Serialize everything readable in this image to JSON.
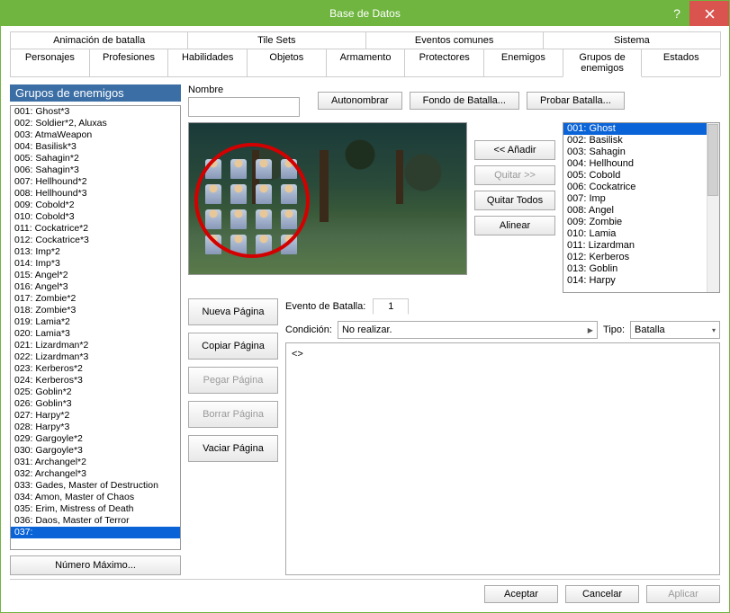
{
  "window": {
    "title": "Base de Datos"
  },
  "tabs_top": {
    "row1": [
      "Animación de batalla",
      "Tile Sets",
      "Eventos comunes",
      "Sistema"
    ],
    "row2": [
      "Personajes",
      "Profesiones",
      "Habilidades",
      "Objetos",
      "Armamento",
      "Protectores",
      "Enemigos",
      "Grupos de enemigos",
      "Estados"
    ],
    "active": "Grupos de enemigos"
  },
  "left": {
    "header": "Grupos de enemigos",
    "max_btn": "Número Máximo...",
    "items": [
      "001: Ghost*3",
      "002: Soldier*2, Aluxas",
      "003: AtmaWeapon",
      "004: Basilisk*3",
      "005: Sahagin*2",
      "006: Sahagin*3",
      "007: Hellhound*2",
      "008: Hellhound*3",
      "009: Cobold*2",
      "010: Cobold*3",
      "011: Cockatrice*2",
      "012: Cockatrice*3",
      "013: Imp*2",
      "014: Imp*3",
      "015: Angel*2",
      "016: Angel*3",
      "017: Zombie*2",
      "018: Zombie*3",
      "019: Lamia*2",
      "020: Lamia*3",
      "021: Lizardman*2",
      "022: Lizardman*3",
      "023: Kerberos*2",
      "024: Kerberos*3",
      "025: Goblin*2",
      "026: Goblin*3",
      "027: Harpy*2",
      "028: Harpy*3",
      "029: Gargoyle*2",
      "030: Gargoyle*3",
      "031: Archangel*2",
      "032: Archangel*3",
      "033: Gades, Master of Destruction",
      "034: Amon, Master of Chaos",
      "035: Erim, Mistress of Death",
      "036: Daos, Master of Terror",
      "037:"
    ],
    "selected_index": 36
  },
  "name": {
    "label": "Nombre",
    "value": ""
  },
  "top_buttons": {
    "auto": "Autonombrar",
    "bg": "Fondo de Batalla...",
    "test": "Probar Batalla..."
  },
  "mid_buttons": {
    "add": "<< Añadir",
    "remove": "Quitar >>",
    "remove_all": "Quitar Todos",
    "align": "Alinear"
  },
  "enemies": {
    "items": [
      "001: Ghost",
      "002: Basilisk",
      "003: Sahagin",
      "004: Hellhound",
      "005: Cobold",
      "006: Cockatrice",
      "007: Imp",
      "008: Angel",
      "009: Zombie",
      "010: Lamia",
      "011: Lizardman",
      "012: Kerberos",
      "013: Goblin",
      "014: Harpy"
    ],
    "selected_index": 0
  },
  "battle_event": {
    "label": "Evento de Batalla:",
    "page": "1",
    "new_page": "Nueva Página",
    "copy_page": "Copiar Página",
    "paste_page": "Pegar Página",
    "delete_page": "Borrar Página",
    "clear_page": "Vaciar Página",
    "cond_label": "Condición:",
    "cond_value": "No realizar.",
    "tipo_label": "Tipo:",
    "tipo_value": "Batalla",
    "script": "<>"
  },
  "dialog": {
    "ok": "Aceptar",
    "cancel": "Cancelar",
    "apply": "Aplicar"
  }
}
